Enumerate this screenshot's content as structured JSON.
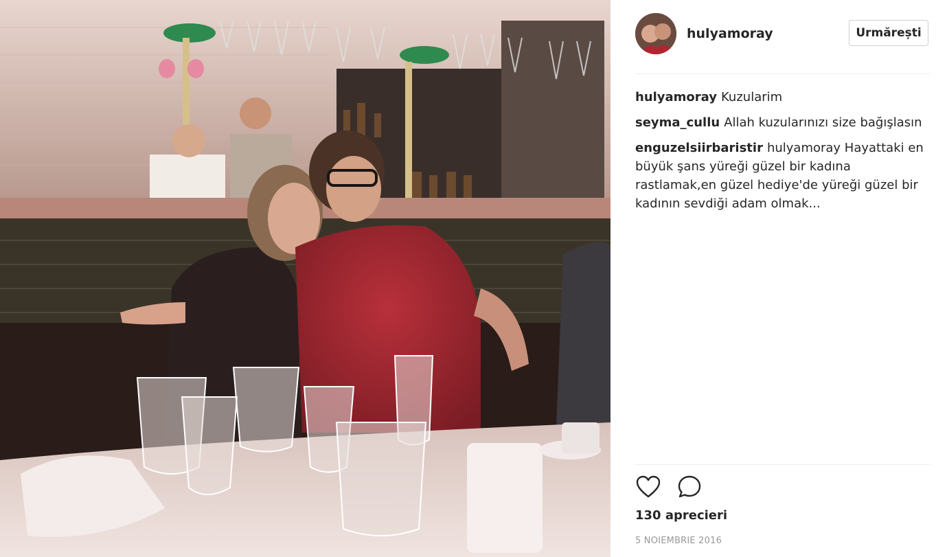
{
  "post": {
    "photo_name": "restaurant-photo"
  },
  "header": {
    "username": "hulyamoray",
    "follow_label": "Urmărești"
  },
  "comments": [
    {
      "author": "hulyamoray",
      "text": "Kuzularim"
    },
    {
      "author": "seyma_cullu",
      "text": "Allah kuzularınızı size bağışlasın"
    },
    {
      "author": "enguzelsiirbaristir",
      "text": "hulyamoray Hayattaki en büyük şans yüreği güzel bir kadına rastlamak,en güzel hediye'de yüreği güzel bir kadının sevdiği adam olmak..."
    }
  ],
  "actions": {
    "like_icon": "heart-icon",
    "comment_icon": "speech-bubble-icon"
  },
  "likes_text": "130 aprecieri",
  "date_text": "5 NOIEMBRIE 2016"
}
